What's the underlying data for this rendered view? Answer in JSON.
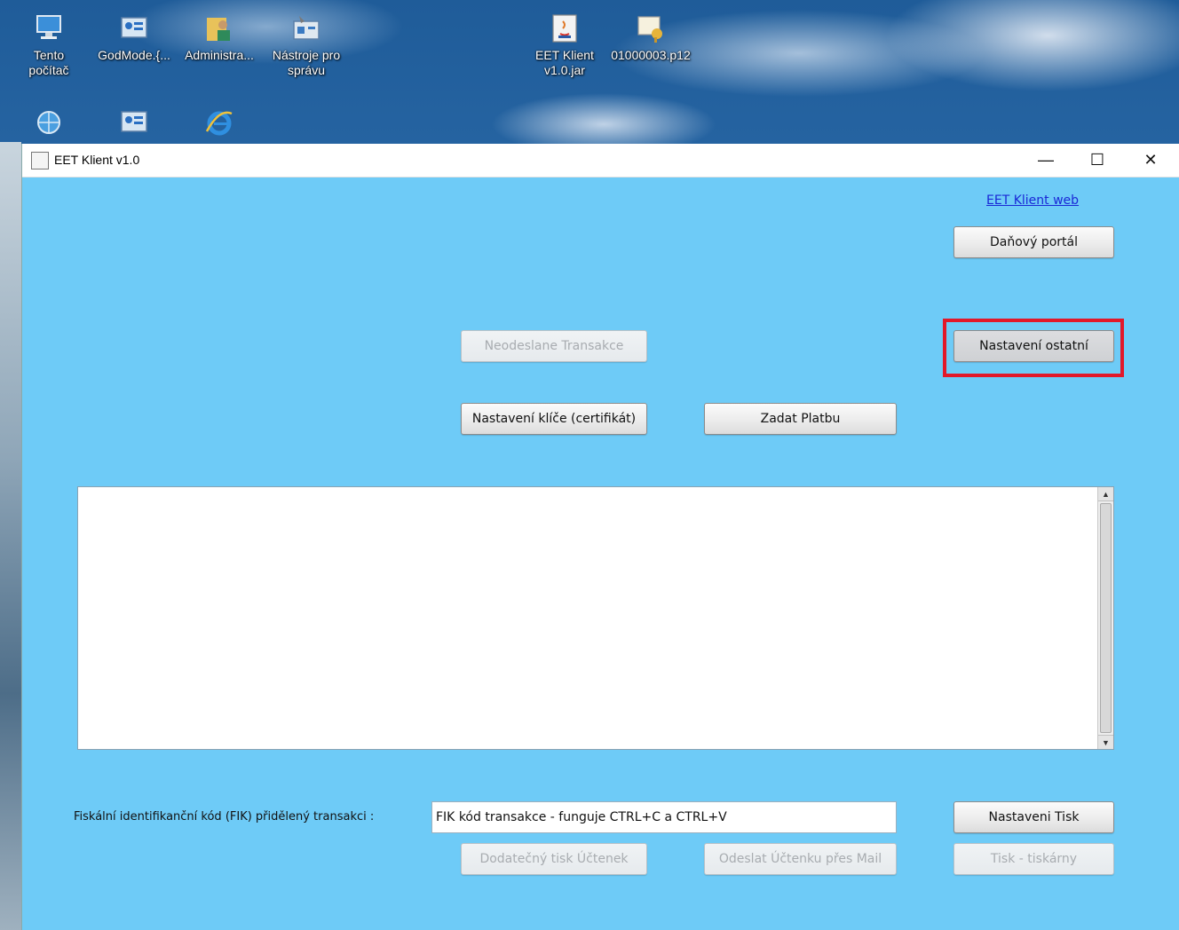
{
  "desktop": {
    "icons": [
      {
        "label_line1": "Tento",
        "label_line2": "počítač",
        "icon": "computer-icon"
      },
      {
        "label_line1": "GodMode.{...",
        "label_line2": "",
        "icon": "control-panel-icon"
      },
      {
        "label_line1": "Administra...",
        "label_line2": "",
        "icon": "user-folder-icon"
      },
      {
        "label_line1": "Nástroje pro",
        "label_line2": "správu",
        "icon": "admin-tools-icon"
      },
      {
        "label_line1": "EET Klient",
        "label_line2": "v1.0.jar",
        "icon": "java-jar-icon"
      },
      {
        "label_line1": "01000003.p12",
        "label_line2": "",
        "icon": "certificate-icon"
      },
      {
        "label_line1": "",
        "label_line2": "",
        "icon": "network-icon"
      },
      {
        "label_line1": "",
        "label_line2": "",
        "icon": "control-panel-icon"
      },
      {
        "label_line1": "",
        "label_line2": "",
        "icon": "internet-explorer-icon"
      }
    ]
  },
  "window": {
    "title": "EET Klient v1.0",
    "controls": {
      "minimize": "—",
      "maximize": "☐",
      "close": "✕"
    },
    "background_color": "#6ecbf7"
  },
  "main": {
    "web_link": "EET Klient web",
    "tax_portal_button": "Daňový portál",
    "other_settings_button": "Nastavení ostatní",
    "unsent_transactions_button": "Neodeslane Transakce",
    "key_settings_button": "Nastavení klíče (certifikát)",
    "enter_payment_button": "Zadat Platbu",
    "log_text": "",
    "fik_label": "Fiskální identifikanční kód (FIK) přidělený transakci :",
    "fik_value": "FIK kód transakce - funguje CTRL+C a CTRL+V",
    "print_settings_button": "Nastaveni Tisk",
    "extra_print_button": "Dodatečný tisk Účtenek",
    "send_mail_button": "Odeslat Účtenku přes Mail",
    "printers_button": "Tisk - tiskárny",
    "highlight_color": "#e2182a"
  }
}
